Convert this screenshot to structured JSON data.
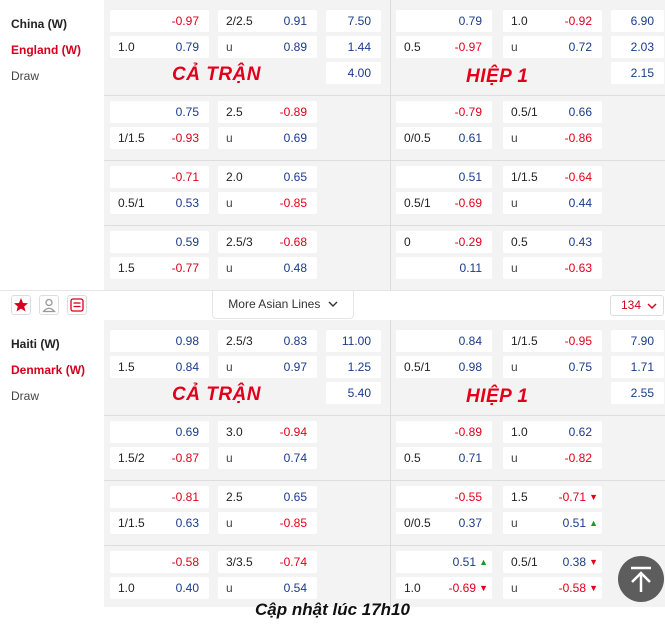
{
  "matches": [
    {
      "home": "China (W)",
      "away": "England (W)",
      "draw": "Draw",
      "full_label": "CẢ TRẬN",
      "half_label": "HIỆP 1",
      "full_1x2": [
        "7.50",
        "1.44",
        "4.00"
      ],
      "half_1x2": [
        "6.90",
        "2.03",
        "2.15"
      ],
      "rows": [
        {
          "fh": {
            "hcp1": "",
            "o1": "-0.97",
            "hcp2": "1.0",
            "o2": "0.79"
          },
          "fo": {
            "l1": "2/2.5",
            "o1": "0.91",
            "l2": "u",
            "o2": "0.89"
          },
          "hh": {
            "hcp1": "",
            "o1": "0.79",
            "hcp2": "0.5",
            "o2": "-0.97"
          },
          "ho": {
            "l1": "1.0",
            "o1": "-0.92",
            "l2": "u",
            "o2": "0.72"
          }
        },
        {
          "fh": {
            "hcp1": "",
            "o1": "0.75",
            "hcp2": "1/1.5",
            "o2": "-0.93"
          },
          "fo": {
            "l1": "2.5",
            "o1": "-0.89",
            "l2": "u",
            "o2": "0.69"
          },
          "hh": {
            "hcp1": "",
            "o1": "-0.79",
            "hcp2": "0/0.5",
            "o2": "0.61"
          },
          "ho": {
            "l1": "0.5/1",
            "o1": "0.66",
            "l2": "u",
            "o2": "-0.86"
          }
        },
        {
          "fh": {
            "hcp1": "",
            "o1": "-0.71",
            "hcp2": "0.5/1",
            "o2": "0.53"
          },
          "fo": {
            "l1": "2.0",
            "o1": "0.65",
            "l2": "u",
            "o2": "-0.85"
          },
          "hh": {
            "hcp1": "",
            "o1": "0.51",
            "hcp2": "0.5/1",
            "o2": "-0.69"
          },
          "ho": {
            "l1": "1/1.5",
            "o1": "-0.64",
            "l2": "u",
            "o2": "0.44"
          }
        },
        {
          "fh": {
            "hcp1": "",
            "o1": "0.59",
            "hcp2": "1.5",
            "o2": "-0.77"
          },
          "fo": {
            "l1": "2.5/3",
            "o1": "-0.68",
            "l2": "u",
            "o2": "0.48"
          },
          "hh": {
            "hcp1": "0",
            "o1": "-0.29",
            "hcp2": "",
            "o2": "0.11"
          },
          "ho": {
            "l1": "0.5",
            "o1": "0.43",
            "l2": "u",
            "o2": "-0.63"
          }
        }
      ]
    },
    {
      "home": "Haiti (W)",
      "away": "Denmark (W)",
      "draw": "Draw",
      "full_label": "CẢ TRẬN",
      "half_label": "HIỆP 1",
      "full_1x2": [
        "11.00",
        "1.25",
        "5.40"
      ],
      "half_1x2": [
        "7.90",
        "1.71",
        "2.55"
      ],
      "rows": [
        {
          "fh": {
            "hcp1": "",
            "o1": "0.98",
            "hcp2": "1.5",
            "o2": "0.84"
          },
          "fo": {
            "l1": "2.5/3",
            "o1": "0.83",
            "l2": "u",
            "o2": "0.97"
          },
          "hh": {
            "hcp1": "",
            "o1": "0.84",
            "hcp2": "0.5/1",
            "o2": "0.98"
          },
          "ho": {
            "l1": "1/1.5",
            "o1": "-0.95",
            "l2": "u",
            "o2": "0.75"
          }
        },
        {
          "fh": {
            "hcp1": "",
            "o1": "0.69",
            "hcp2": "1.5/2",
            "o2": "-0.87"
          },
          "fo": {
            "l1": "3.0",
            "o1": "-0.94",
            "l2": "u",
            "o2": "0.74"
          },
          "hh": {
            "hcp1": "",
            "o1": "-0.89",
            "hcp2": "0.5",
            "o2": "0.71"
          },
          "ho": {
            "l1": "1.0",
            "o1": "0.62",
            "l2": "u",
            "o2": "-0.82"
          }
        },
        {
          "fh": {
            "hcp1": "",
            "o1": "-0.81",
            "hcp2": "1/1.5",
            "o2": "0.63"
          },
          "fo": {
            "l1": "2.5",
            "o1": "0.65",
            "l2": "u",
            "o2": "-0.85"
          },
          "hh": {
            "hcp1": "",
            "o1": "-0.55",
            "hcp2": "0/0.5",
            "o2": "0.37"
          },
          "ho": {
            "l1": "1.5",
            "o1": "-0.71",
            "l2": "u",
            "o2": "0.51",
            "a1": "down",
            "a2": "up"
          }
        },
        {
          "fh": {
            "hcp1": "",
            "o1": "-0.58",
            "hcp2": "1.0",
            "o2": "0.40"
          },
          "fo": {
            "l1": "3/3.5",
            "o1": "-0.74",
            "l2": "u",
            "o2": "0.54"
          },
          "hh": {
            "hcp1": "",
            "o1": "0.51",
            "hcp2": "1.0",
            "o2": "-0.69",
            "a1": "up",
            "a2": "down"
          },
          "ho": {
            "l1": "0.5/1",
            "o1": "0.38",
            "l2": "u",
            "o2": "-0.58",
            "a1": "down",
            "a2": "down"
          }
        }
      ]
    }
  ],
  "toolbar": {
    "more_lines": "More Asian Lines",
    "count": "134",
    "icons": [
      "star-icon",
      "person-icon",
      "list-icon"
    ]
  },
  "footer": "Cập nhật lúc 17h10",
  "colors": {
    "negative": "#e0001c",
    "positive": "#1a3a8a",
    "away_team": "#d4001c",
    "label": "#e0001c"
  }
}
